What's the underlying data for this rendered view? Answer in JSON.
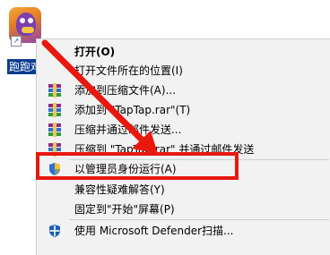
{
  "desktop": {
    "icon_label": "跑跑鸡"
  },
  "menu": {
    "items": [
      {
        "label": "打开(O)",
        "icon": "none",
        "bold": true
      },
      {
        "label": "打开文件所在的位置(I)",
        "icon": "none"
      },
      {
        "label": "添加到压缩文件(A)...",
        "icon": "winrar-icon"
      },
      {
        "label": "添加到 \"TapTap.rar\"(T)",
        "icon": "winrar-icon"
      },
      {
        "label": "压缩并通过邮件发送...",
        "icon": "winrar-icon"
      },
      {
        "label": "压缩到 \"TapTap.rar\" 并通过邮件发送",
        "icon": "winrar-icon"
      },
      {
        "label": "以管理员身份运行(A)",
        "icon": "uac-shield-icon"
      },
      {
        "label": "兼容性疑难解答(Y)",
        "icon": "none"
      },
      {
        "label": "固定到\"开始\"屏幕(P)",
        "icon": "none"
      },
      {
        "label": "使用 Microsoft Defender扫描...",
        "icon": "defender-shield-icon"
      }
    ]
  },
  "annotation": {
    "highlight_color": "#e8180f",
    "arrow_color": "#e8180f"
  }
}
